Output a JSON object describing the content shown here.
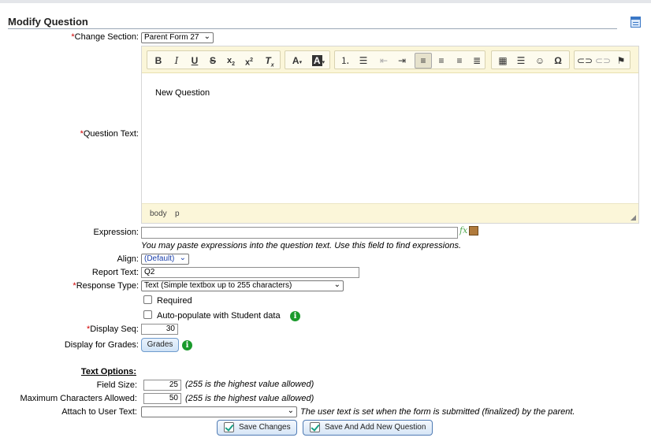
{
  "page": {
    "title": "Modify Question"
  },
  "form": {
    "change_section": {
      "label": "Change Section:",
      "value": "Parent Form 27"
    },
    "question_text": {
      "label": "Question Text:",
      "content": "New Question",
      "status_path": [
        "body",
        "p"
      ]
    },
    "expression": {
      "label": "Expression:",
      "value": "",
      "hint": "You may paste expressions into the question text. Use this field to find expressions.",
      "fx_label": "fx"
    },
    "align": {
      "label": "Align:",
      "value": "(Default)"
    },
    "report_text": {
      "label": "Report Text:",
      "value": "Q2"
    },
    "response_type": {
      "label": "Response Type:",
      "value": "Text (Simple textbox up to 255 characters)"
    },
    "required": {
      "label": "Required",
      "checked": false
    },
    "auto_populate": {
      "label": "Auto-populate with Student data",
      "checked": false
    },
    "display_seq": {
      "label": "Display Seq:",
      "value": "30"
    },
    "display_grades": {
      "label": "Display for Grades:",
      "button": "Grades"
    },
    "text_options": {
      "heading": "Text Options:",
      "field_size": {
        "label": "Field Size:",
        "value": "25",
        "hint": "(255 is the highest value allowed)"
      },
      "max_chars": {
        "label": "Maximum Characters Allowed:",
        "value": "50",
        "hint": "(255 is the highest value allowed)"
      },
      "attach_user_text": {
        "label": "Attach to User Text:",
        "value": "",
        "hint": "The user text is set when the form is submitted (finalized) by the parent."
      }
    }
  },
  "actions": {
    "save_changes": "Save Changes",
    "save_and_add": "Save And Add New Question"
  },
  "required_marker": "*",
  "icons": [
    "calendar-icon",
    "bold-icon",
    "italic-icon",
    "underline-icon",
    "strikethrough-icon",
    "subscript-icon",
    "superscript-icon",
    "remove-format-icon",
    "text-color-icon",
    "background-color-icon",
    "numbered-list-icon",
    "bulleted-list-icon",
    "outdent-icon",
    "indent-icon",
    "align-left-icon",
    "align-center-icon",
    "align-right-icon",
    "justify-icon",
    "table-icon",
    "horizontal-line-icon",
    "smiley-icon",
    "special-char-icon",
    "link-icon",
    "unlink-icon",
    "anchor-icon",
    "info-icon",
    "package-icon"
  ],
  "colors": {
    "required": "#d00000",
    "info": "#1a9a2c",
    "toolbar": "#fbf6d9"
  }
}
